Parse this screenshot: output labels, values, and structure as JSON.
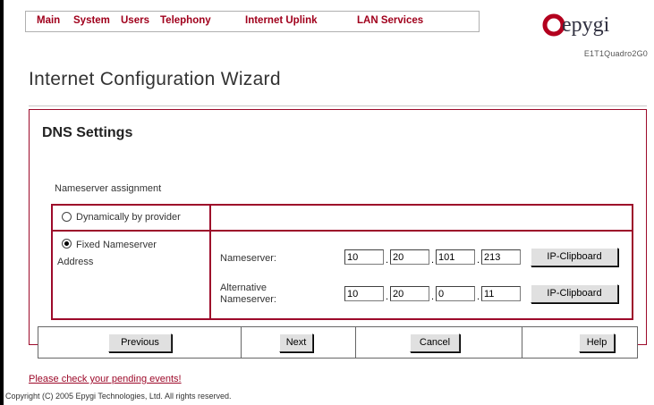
{
  "nav": {
    "items": [
      "Main",
      "System",
      "Users",
      "Telephony",
      "Internet Uplink",
      "LAN Services"
    ]
  },
  "brand": {
    "logo_text": "epygi",
    "model": "E1T1Quadro2G0",
    "accent_color": "#9d0a2a"
  },
  "page_title": "Internet Configuration Wizard",
  "section_title": "DNS Settings",
  "assignment_label": "Nameserver assignment",
  "options": {
    "dynamic": {
      "label": "Dynamically by provider",
      "checked": false
    },
    "fixed": {
      "label_line1": "Fixed Nameserver",
      "label_line2": "Address",
      "checked": true
    }
  },
  "nameserver": {
    "label": "Nameserver:",
    "octets": [
      "10",
      "20",
      "101",
      "213"
    ],
    "clipboard_label": "IP-Clipboard"
  },
  "alt_nameserver": {
    "label_line1": "Alternative",
    "label_line2": "Nameserver:",
    "octets": [
      "10",
      "20",
      "0",
      "11"
    ],
    "clipboard_label": "IP-Clipboard"
  },
  "buttons": {
    "previous": "Previous",
    "next": "Next",
    "cancel": "Cancel",
    "help": "Help"
  },
  "pending_link": "Please check your pending events!",
  "copyright": "Copyright (C) 2005 Epygi Technologies, Ltd. All rights reserved."
}
